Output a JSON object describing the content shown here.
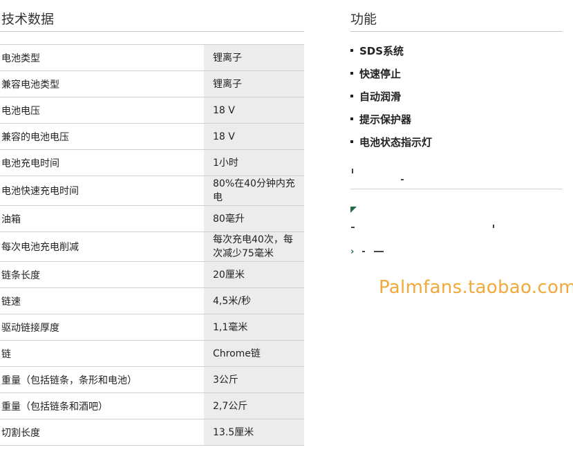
{
  "specs": {
    "title": "技术数据",
    "rows": [
      {
        "label": "电池类型",
        "value": "锂离子"
      },
      {
        "label": "兼容电池类型",
        "value": "锂离子"
      },
      {
        "label": "电池电压",
        "value": "18 V"
      },
      {
        "label": "兼容的电池电压",
        "value": "18 V"
      },
      {
        "label": "电池充电时间",
        "value": "1小时"
      },
      {
        "label": "电池快速充电时间",
        "value": "80%在40分钟内充电"
      },
      {
        "label": "油箱",
        "value": "80毫升"
      },
      {
        "label": "每次电池充电削减",
        "value": "每次充电40次，每次减少75毫米"
      },
      {
        "label": "链条长度",
        "value": "20厘米"
      },
      {
        "label": "链速",
        "value": "4,5米/秒"
      },
      {
        "label": "驱动链接厚度",
        "value": "1,1毫米"
      },
      {
        "label": "链",
        "value": "Chrome链"
      },
      {
        "label": "重量（包括链条，条形和电池）",
        "value": "3公斤"
      },
      {
        "label": "重量（包括链条和酒吧）",
        "value": "2,7公斤"
      },
      {
        "label": "切割长度",
        "value": "13.5厘米"
      }
    ]
  },
  "features": {
    "title": "功能",
    "items": [
      "SDS系统",
      "快速停止",
      "自动润滑",
      "提示保护器",
      "电池状态指示灯"
    ]
  },
  "watermark": "Palmfans.taobao.com",
  "colors": {
    "accent_green": "#1f6e43",
    "watermark": "#f2a93b",
    "value_bg": "#ececec"
  }
}
